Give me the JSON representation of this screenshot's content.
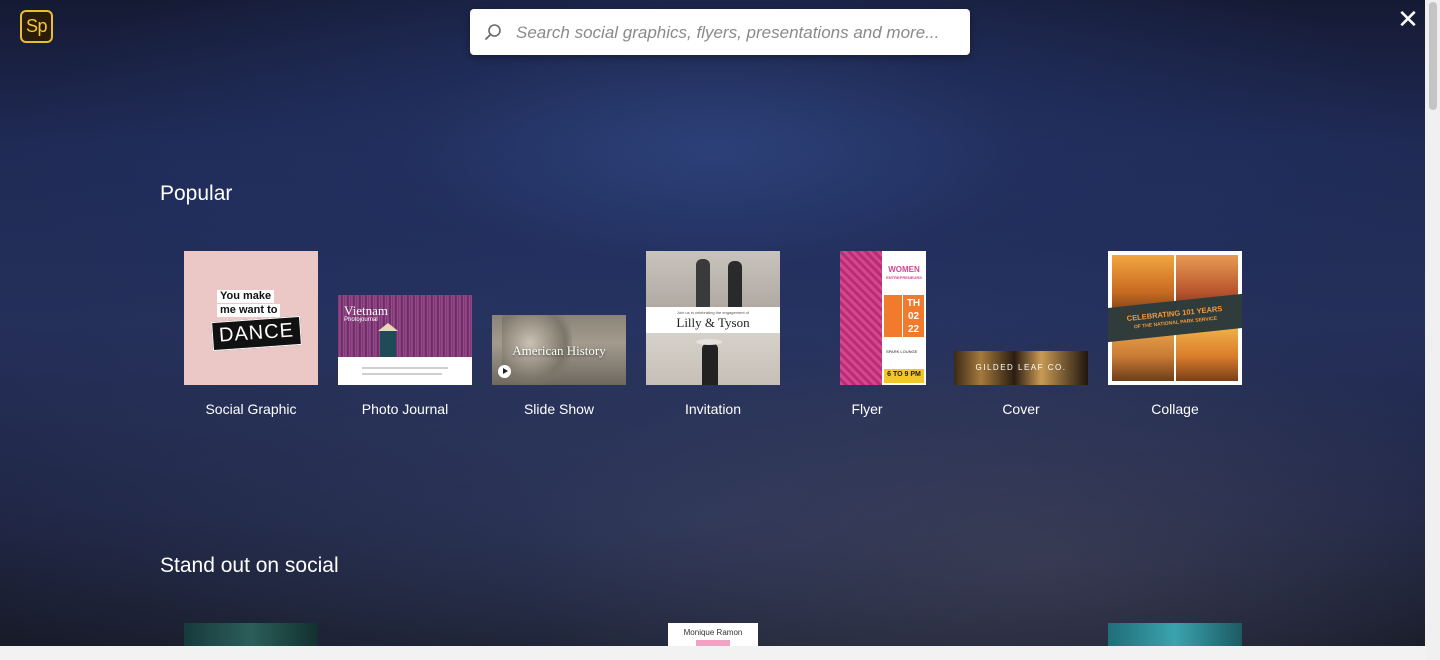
{
  "app": {
    "logo_text": "Sp",
    "close_symbol": "✕"
  },
  "search": {
    "placeholder": "Search social graphics, flyers, presentations and more..."
  },
  "sections": [
    {
      "title": "Popular",
      "items": [
        {
          "label": "Social Graphic",
          "thumb_text": [
            "You make",
            "me want to",
            "DANCE"
          ]
        },
        {
          "label": "Photo Journal",
          "thumb_text": [
            "Vietnam",
            "Photojournal"
          ]
        },
        {
          "label": "Slide Show",
          "thumb_text": [
            "American History"
          ]
        },
        {
          "label": "Invitation",
          "thumb_text": [
            "Join us in celebrating the engagement of",
            "Lilly & Tyson"
          ]
        },
        {
          "label": "Flyer",
          "thumb_text": [
            "WOMEN",
            "ENTREPRENEURS",
            "TH",
            "02",
            "22",
            "SPARK LOUNGE",
            "6 TO 9 PM"
          ]
        },
        {
          "label": "Cover",
          "thumb_text": [
            "GILDED LEAF CO."
          ]
        },
        {
          "label": "Collage",
          "thumb_text": [
            "CELEBRATING 101 YEARS",
            "OF THE NATIONAL PARK SERVICE"
          ]
        }
      ]
    },
    {
      "title": "Stand out on social",
      "items": [
        {
          "thumb_text": []
        },
        {
          "thumb_text": [
            "Monique Ramon"
          ]
        },
        {
          "thumb_text": []
        }
      ]
    }
  ],
  "colors": {
    "logo_border": "#e9be2f",
    "background": "#1f2a55",
    "search_bg": "#ffffff"
  }
}
